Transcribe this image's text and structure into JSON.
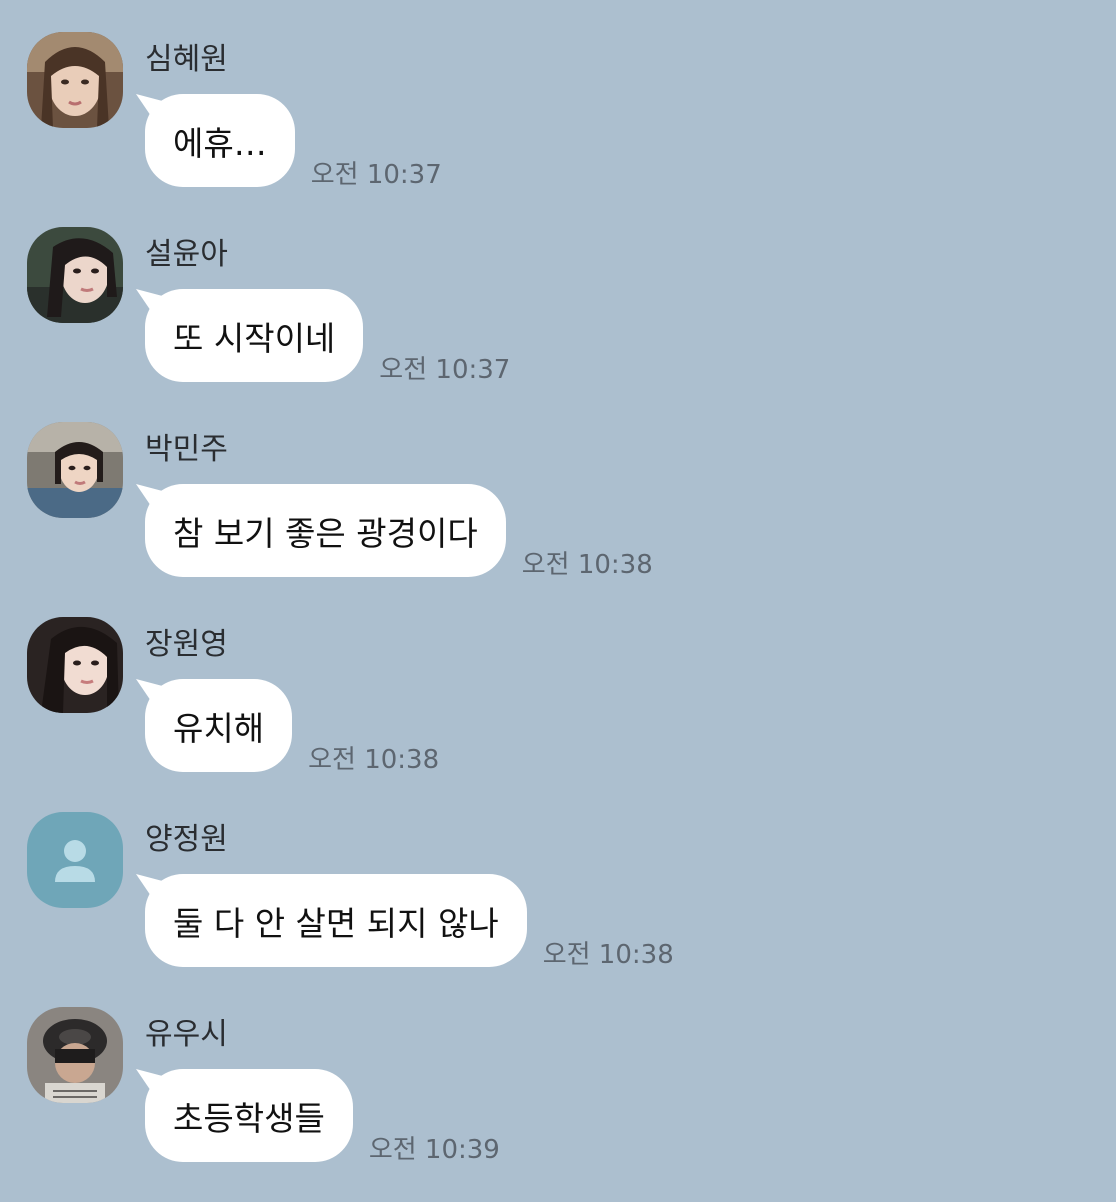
{
  "messages": [
    {
      "sender": "심혜원",
      "text": "에휴…",
      "time": "오전 10:37",
      "avatar": "photo"
    },
    {
      "sender": "설윤아",
      "text": "또 시작이네",
      "time": "오전 10:37",
      "avatar": "photo"
    },
    {
      "sender": "박민주",
      "text": "참 보기 좋은 광경이다",
      "time": "오전 10:38",
      "avatar": "photo"
    },
    {
      "sender": "장원영",
      "text": "유치해",
      "time": "오전 10:38",
      "avatar": "photo"
    },
    {
      "sender": "양정원",
      "text": "둘 다 안 살면 되지 않나",
      "time": "오전 10:38",
      "avatar": "default-profile-icon"
    },
    {
      "sender": "유우시",
      "text": "초등학생들",
      "time": "오전 10:39",
      "avatar": "photo"
    }
  ],
  "colors": {
    "background": "#acbfcf",
    "bubble": "#ffffff",
    "default_avatar": "#6fa6b8"
  }
}
